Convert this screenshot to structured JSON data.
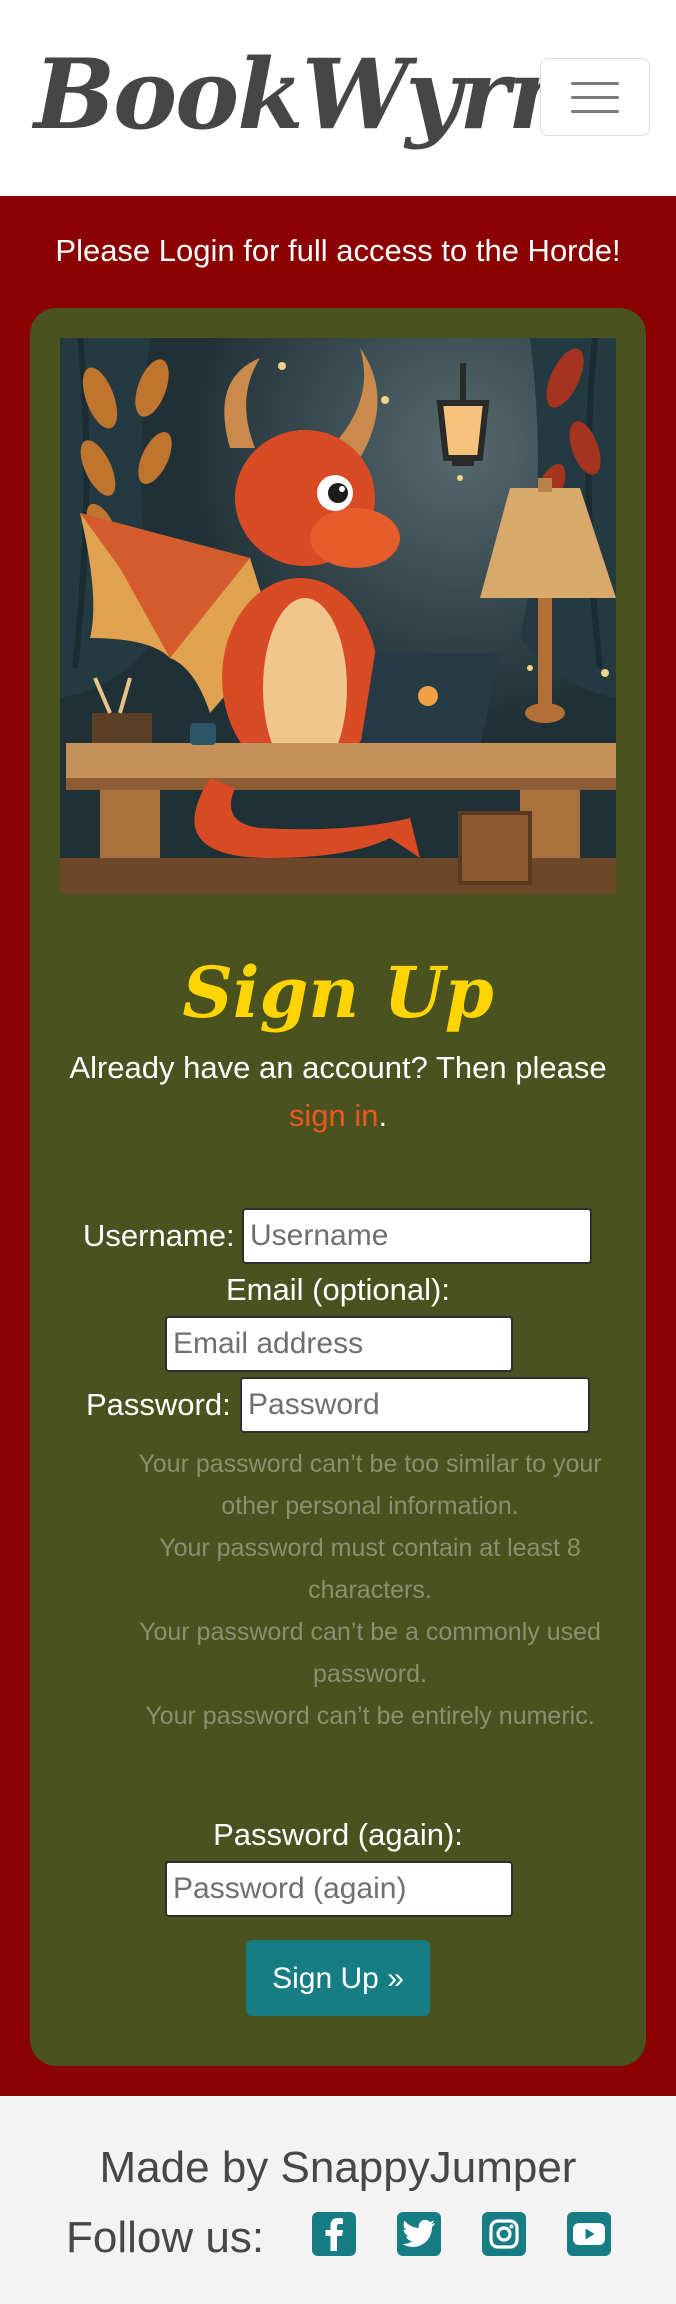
{
  "brand": {
    "title": "BookWyrm"
  },
  "banner": {
    "message": "Please Login for full access to the Horde!"
  },
  "signup": {
    "title": "Sign Up",
    "intro_text": "Already have an account? Then please",
    "signin_link": "sign in",
    "intro_end": "."
  },
  "form": {
    "username_label": "Username:",
    "username_placeholder": "Username",
    "email_label": "Email (optional):",
    "email_placeholder": "Email address",
    "password_label": "Password:",
    "password_placeholder": "Password",
    "password_help": [
      "Your password can’t be too similar to your other personal information.",
      "Your password must contain at least 8 characters.",
      "Your password can’t be a commonly used password.",
      "Your password can’t be entirely numeric."
    ],
    "password2_label": "Password (again):",
    "password2_placeholder": "Password (again)",
    "submit_label": "Sign Up »"
  },
  "footer": {
    "made_by": "Made by SnappyJumper",
    "follow_label": "Follow us:",
    "social": [
      "facebook-icon",
      "twitter-icon",
      "instagram-icon",
      "youtube-icon"
    ]
  },
  "colors": {
    "page_background": "#8b0000",
    "card_background": "#4a5220",
    "title": "#ffd400",
    "link": "#e85a1f",
    "button": "#167d84"
  }
}
